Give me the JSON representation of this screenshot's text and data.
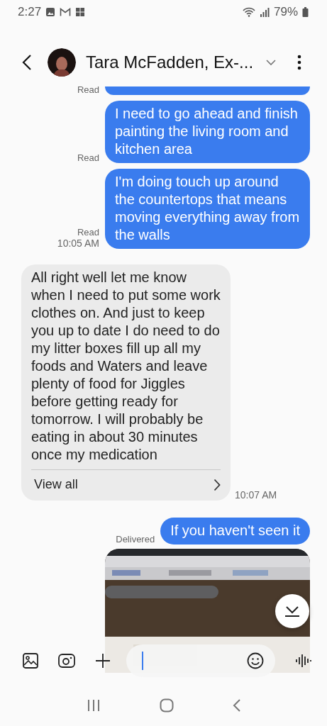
{
  "status_bar": {
    "time": "2:27",
    "battery": "79%"
  },
  "header": {
    "title": "Tara McFadden, Ex-..."
  },
  "messages": [
    {
      "kind": "sent_cut",
      "status": "Read"
    },
    {
      "kind": "sent",
      "text": "I need to go ahead and finish painting the living room and kitchen area",
      "status": "Read"
    },
    {
      "kind": "sent",
      "text": "I'm doing touch up around the countertops that means moving everything away from the walls",
      "status": "Read",
      "time": "10:05 AM"
    },
    {
      "kind": "received",
      "text": "All right well let me know when I need to put some work clothes on. And just to keep you up to date I do need to do my litter boxes fill up all my foods and Waters and leave plenty of food for Jiggles before getting ready for tomorrow. I will probably be eating in about 30 minutes once my medication",
      "link": "View all",
      "time": "10:07 AM"
    },
    {
      "kind": "sent",
      "text": "If you haven't seen it",
      "status": "Delivered"
    },
    {
      "kind": "picture"
    }
  ]
}
